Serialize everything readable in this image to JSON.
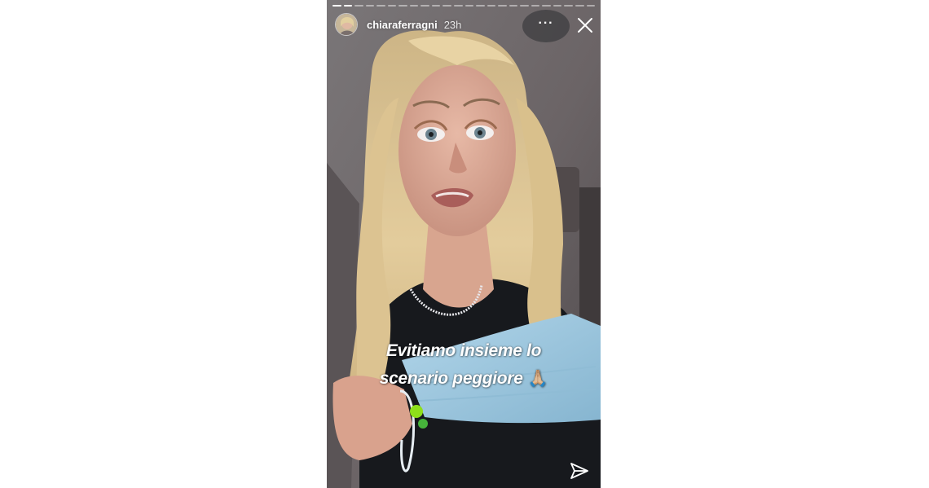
{
  "story": {
    "username": "chiaraferragni",
    "time": "23h",
    "progress_segments_total": 24,
    "progress_segments_done": 2,
    "caption_line1": "Evitiamo insieme lo",
    "caption_line2": "scenario peggiore",
    "caption_emoji": "🙏🏼"
  },
  "icons": {
    "more": "more-options-icon",
    "close": "close-icon",
    "send": "send-icon"
  },
  "colors": {
    "text": "#ffffff",
    "mask": "#9fc6dd",
    "hair": "#d8bf8e"
  }
}
